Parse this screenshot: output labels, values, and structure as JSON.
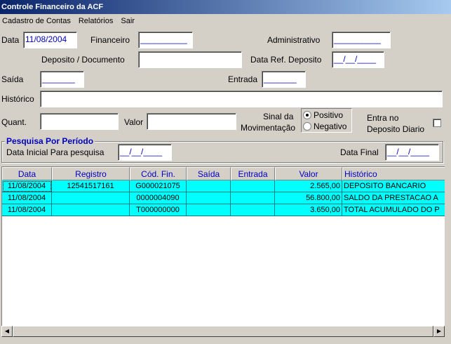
{
  "window": {
    "title": "Controle Financeiro da ACF"
  },
  "menu": [
    "Cadastro de Contas",
    "Relatórios",
    "Sair"
  ],
  "form": {
    "data_label": "Data",
    "data_value": "11/08/2004",
    "financeiro_label": "Financeiro",
    "financeiro_value": "__________",
    "administrativo_label": "Administrativo",
    "administrativo_value": "__________",
    "deposito_label": "Deposito / Documento",
    "deposito_value": "",
    "data_ref_label": "Data Ref. Deposito",
    "data_ref_value": "__/__/____",
    "saida_label": "Saída",
    "saida_value": "_______",
    "entrada_label": "Entrada",
    "entrada_value": "_______",
    "historico_label": "Histórico",
    "historico_value": "",
    "quant_label": "Quant.",
    "quant_value": "",
    "valor_label": "Valor",
    "valor_value": "",
    "sinal_label_1": "Sinal da",
    "sinal_label_2": "Movimentação",
    "radio_positivo": "Positivo",
    "radio_negativo": "Negativo",
    "radio_selected": "Positivo",
    "entra_label_1": "Entra no",
    "entra_label_2": "Deposito Diario",
    "entra_checked": false
  },
  "period": {
    "title": "Pesquisa Por Período",
    "inicial_label": "Data Inicial Para pesquisa",
    "inicial_value": "__/__/____",
    "final_label": "Data Final",
    "final_value": "__/__/____"
  },
  "grid": {
    "columns": [
      "Data",
      "Registro",
      "Cód. Fin.",
      "Saída",
      "Entrada",
      "Valor",
      "Histórico"
    ],
    "rows": [
      [
        "11/08/2004",
        "12541517161",
        "G000021075",
        "",
        "",
        "2.565,00",
        "DEPOSITO BANCARIO"
      ],
      [
        "11/08/2004",
        "",
        "0000004090",
        "",
        "",
        "56.800,00",
        "SALDO DA PRESTACAO A"
      ],
      [
        "11/08/2004",
        "",
        "T000000000",
        "",
        "",
        "3.650,00",
        "TOTAL ACUMULADO DO P"
      ]
    ],
    "row_color": "#00ffff"
  },
  "colors": {
    "accent": "#0000c0",
    "titlebar": "#0a246a"
  }
}
